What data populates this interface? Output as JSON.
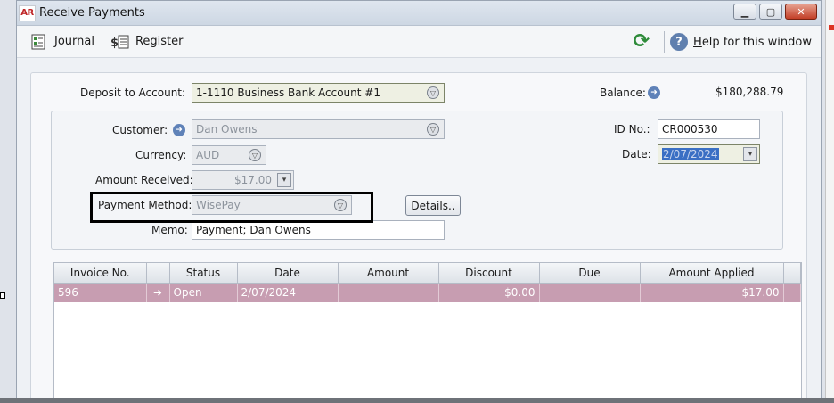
{
  "window": {
    "app_badge": "AR",
    "title": "Receive Payments"
  },
  "toolbar": {
    "journal_label": "Journal",
    "register_label": "Register",
    "help_label": "Help for this window"
  },
  "form": {
    "deposit_label": "Deposit to Account:",
    "deposit_value": "1-1110 Business Bank Account #1",
    "balance_label": "Balance:",
    "balance_value": "$180,288.79",
    "customer_label": "Customer:",
    "customer_value": "Dan Owens",
    "currency_label": "Currency:",
    "currency_value": "AUD",
    "amount_label": "Amount Received:",
    "amount_value": "$17.00",
    "payment_method_label": "Payment Method:",
    "payment_method_value": "WisePay",
    "details_label": "Details..",
    "memo_label": "Memo:",
    "memo_value": "Payment; Dan Owens",
    "id_label": "ID No.:",
    "id_value": "CR000530",
    "date_label": "Date:",
    "date_value": "2/07/2024"
  },
  "table": {
    "columns": [
      "Invoice No.",
      "",
      "Status",
      "Date",
      "Amount",
      "Discount",
      "Due",
      "Amount Applied"
    ],
    "rows": [
      {
        "invoice": "596",
        "status": "Open",
        "date": "2/07/2024",
        "amount": "",
        "discount": "$0.00",
        "due": "",
        "applied": "$17.00"
      }
    ]
  },
  "icons": {
    "journal": "journal-icon",
    "register": "register-icon",
    "refresh": "refresh-icon",
    "help": "help-icon"
  },
  "colors": {
    "row_highlight": "#c79db1",
    "refresh_green": "#2e8b3a",
    "close_red": "#c33f27"
  }
}
